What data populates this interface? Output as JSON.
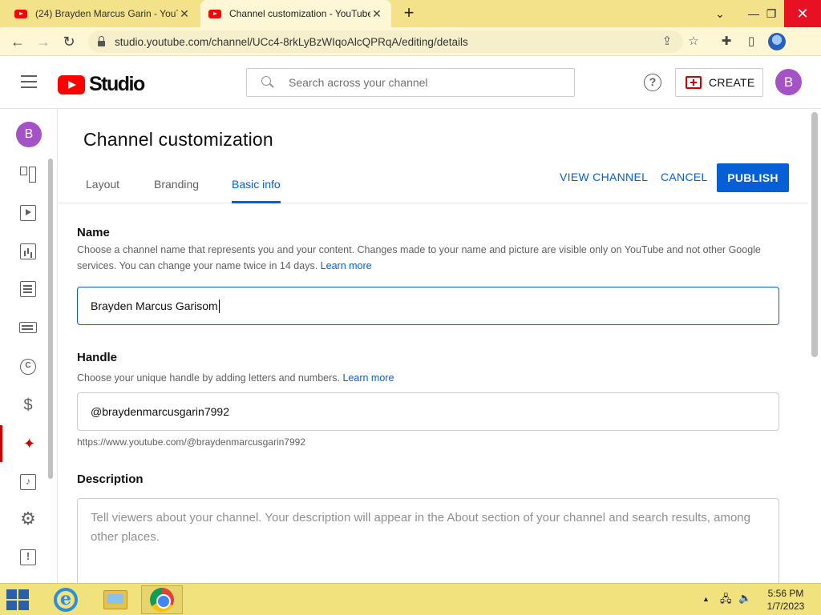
{
  "browser": {
    "tabs": [
      {
        "title": "(24) Brayden Marcus Garin - YouT",
        "active": false
      },
      {
        "title": "Channel customization - YouTube",
        "active": true
      }
    ],
    "new_tab": "+",
    "url": "studio.youtube.com/channel/UCc4-8rkLyBzWIqoAlcQPRqA/editing/details",
    "window_controls": {
      "chevron": "⌄",
      "minimize": "—",
      "restore": "❐",
      "close": "✕"
    }
  },
  "header": {
    "logo_text": "Studio",
    "search_placeholder": "Search across your channel",
    "create_label": "CREATE",
    "avatar_initial": "B"
  },
  "nav": {
    "avatar_initial": "B",
    "items": [
      {
        "id": "dashboard",
        "icon": "dashboard-icon",
        "active": false
      },
      {
        "id": "content",
        "icon": "content-icon",
        "active": false
      },
      {
        "id": "analytics",
        "icon": "analytics-icon",
        "active": false
      },
      {
        "id": "comments",
        "icon": "comments-icon",
        "active": false
      },
      {
        "id": "subtitles",
        "icon": "subtitles-icon",
        "active": false
      },
      {
        "id": "copyright",
        "icon": "copyright-icon",
        "active": false
      },
      {
        "id": "earn",
        "icon": "earn-icon",
        "active": false
      },
      {
        "id": "customization",
        "icon": "customization-icon",
        "active": true
      },
      {
        "id": "audio-library",
        "icon": "audio-library-icon",
        "active": false
      },
      {
        "id": "settings",
        "icon": "settings-icon",
        "active": false
      },
      {
        "id": "feedback",
        "icon": "feedback-icon",
        "active": false
      }
    ],
    "glyphs": {
      "copyright": "C",
      "earn": "$",
      "customization": "✦",
      "audio": "♪",
      "settings": "⚙",
      "feedback": "!"
    }
  },
  "main": {
    "title": "Channel customization",
    "tabs": [
      {
        "label": "Layout",
        "active": false
      },
      {
        "label": "Branding",
        "active": false
      },
      {
        "label": "Basic info",
        "active": true
      }
    ],
    "actions": {
      "view_channel": "VIEW CHANNEL",
      "cancel": "CANCEL",
      "publish": "PUBLISH"
    },
    "name_section": {
      "title": "Name",
      "description": "Choose a channel name that represents you and your content. Changes made to your name and picture are visible only on YouTube and not other Google services. You can change your name twice in 14 days.",
      "learn_more": "Learn more",
      "value": "Brayden Marcus Garisom"
    },
    "handle_section": {
      "title": "Handle",
      "description": "Choose your unique handle by adding letters and numbers.",
      "learn_more": "Learn more",
      "value": "@braydenmarcusgarin7992",
      "url": "https://www.youtube.com/@braydenmarcusgarin7992"
    },
    "description_section": {
      "title": "Description",
      "placeholder": "Tell viewers about your channel. Your description will appear in the About section of your channel and search results, among other places."
    }
  },
  "taskbar": {
    "time": "5:56 PM",
    "date": "1/7/2023",
    "tray_up": "▲"
  },
  "colors": {
    "accent": "#065fd4",
    "brand_red": "#ff0000",
    "avatar": "#a652c7",
    "taskbar": "#f1e27e"
  }
}
